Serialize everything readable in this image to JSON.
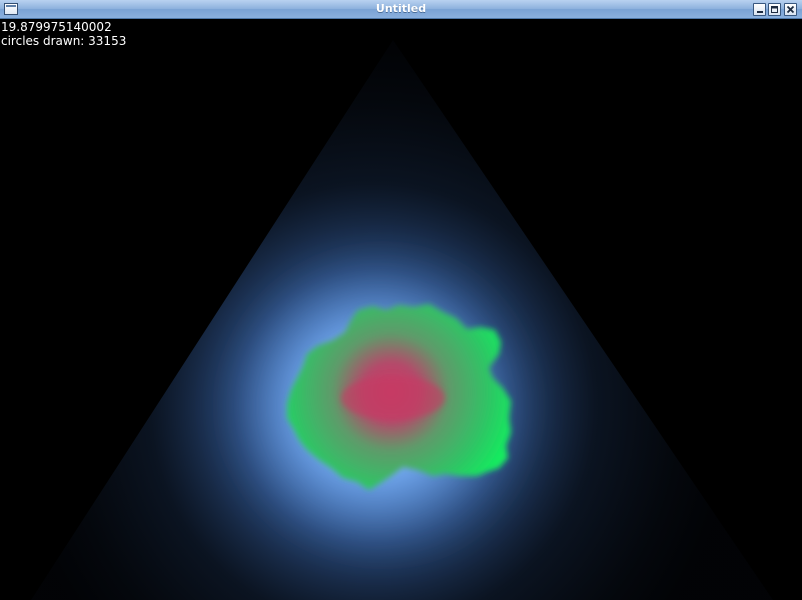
{
  "window": {
    "title": "Untitled"
  },
  "hud": {
    "value_line": "19.879975140002",
    "circles_line": "circles drawn: 33153"
  },
  "scene": {
    "description_icons": [
      "triangle-glow",
      "green-blob",
      "red-core"
    ],
    "colors": {
      "background": "#000000",
      "glow_blue": "#5e9cf5",
      "blob_green": "#14ee5f",
      "core_red": "#c23a63"
    }
  },
  "titlebar_buttons": [
    "minimize-icon",
    "maximize-icon",
    "close-icon"
  ]
}
